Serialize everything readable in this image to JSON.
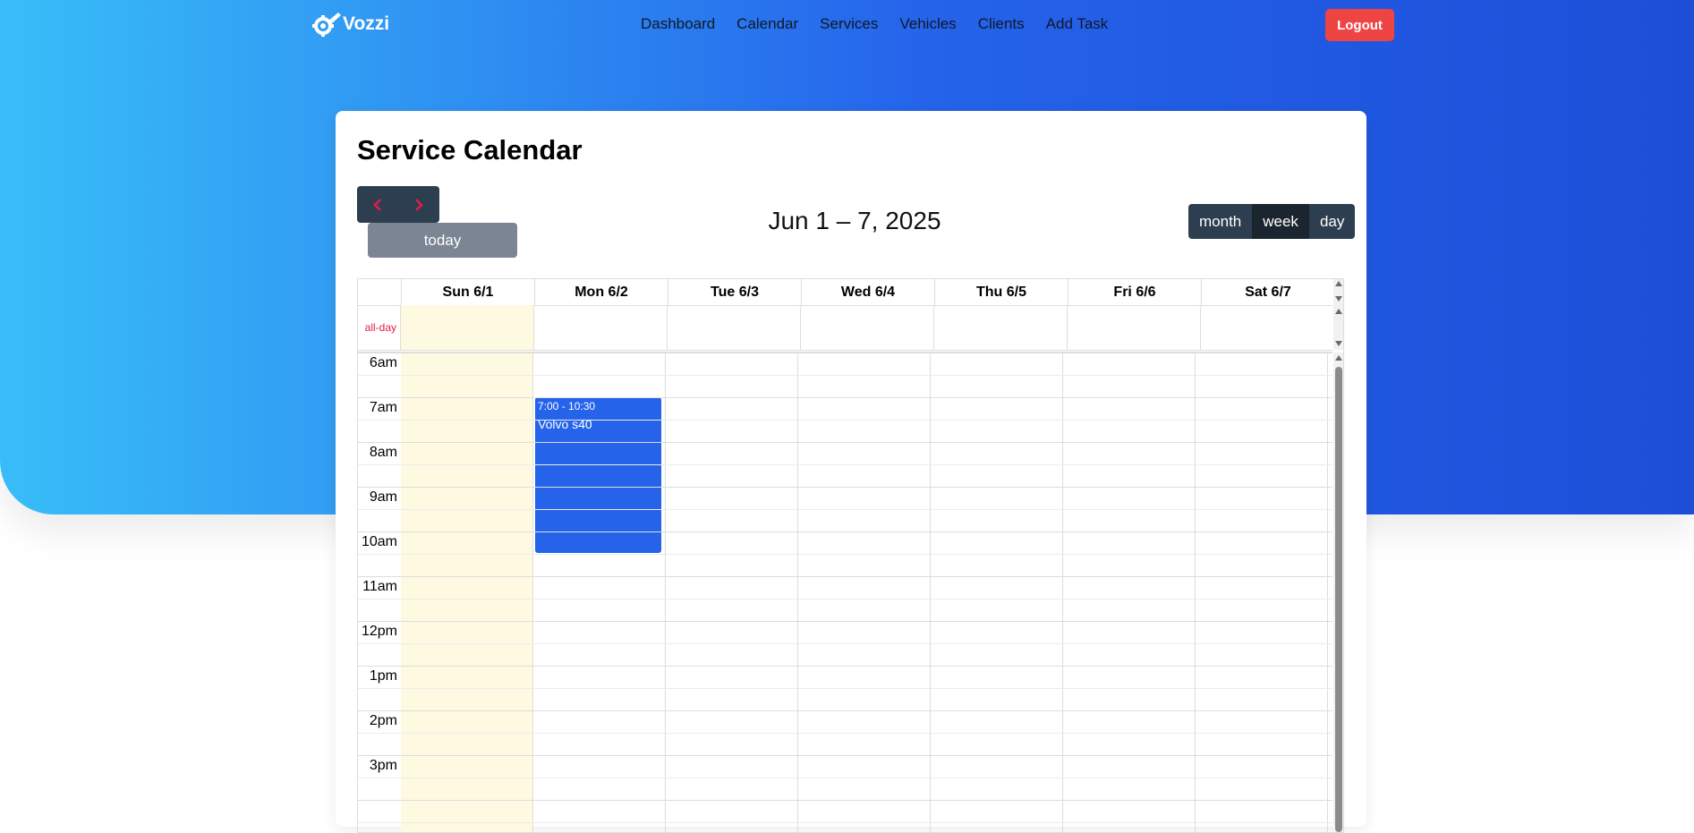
{
  "brand": {
    "name": "Vozzi"
  },
  "nav": {
    "items": [
      "Dashboard",
      "Calendar",
      "Services",
      "Vehicles",
      "Clients",
      "Add Task"
    ],
    "logout_label": "Logout"
  },
  "page": {
    "title": "Service Calendar"
  },
  "toolbar": {
    "prev_icon": "chevron-left-icon",
    "next_icon": "chevron-right-icon",
    "today_label": "today",
    "range_label": "Jun 1 – 7, 2025",
    "views": [
      "month",
      "week",
      "day"
    ],
    "active_view": "week"
  },
  "calendar": {
    "allday_label": "all-day",
    "days": [
      "Sun 6/1",
      "Mon 6/2",
      "Tue 6/3",
      "Wed 6/4",
      "Thu 6/5",
      "Fri 6/6",
      "Sat 6/7"
    ],
    "today_index": 0,
    "time_labels": [
      "6am",
      "7am",
      "8am",
      "9am",
      "10am",
      "11am",
      "12pm",
      "1pm",
      "2pm",
      "3pm"
    ],
    "events": [
      {
        "time": "7:00 - 10:30",
        "title": "Volvo s40",
        "day_index": 1,
        "start_hour": 7.0,
        "end_hour": 10.5,
        "color": "#2563eb"
      }
    ]
  },
  "colors": {
    "accent": "#2563eb",
    "logout": "#ef4444",
    "today_bg": "#fef9e1",
    "toolbar": "#2c3e50"
  }
}
